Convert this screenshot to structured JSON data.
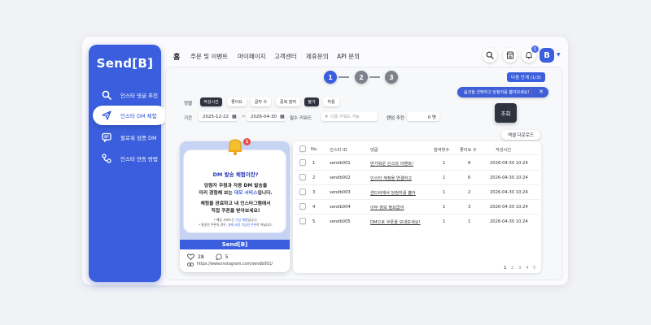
{
  "brand": "Send[B]",
  "sidebar": {
    "items": [
      {
        "label": "인스타 댓글 추천",
        "icon": "search-icon",
        "active": false
      },
      {
        "label": "인스타 DM 체험",
        "icon": "paper-plane-icon",
        "active": true
      },
      {
        "label": "팔로워 검증 DM",
        "icon": "chat-icon",
        "active": false
      },
      {
        "label": "인스타 연동 방법",
        "icon": "link-icon",
        "active": false
      }
    ]
  },
  "header": {
    "home": "홈",
    "menu": [
      "주문 및 이벤트",
      "마이페이지",
      "고객센터",
      "제휴문의",
      "API 문의"
    ],
    "notification_count": "1",
    "avatar": "B"
  },
  "steps": [
    "1",
    "2",
    "3"
  ],
  "active_step": "1",
  "next_step_label": "다음 단계 (1/3)",
  "tooltip": "옵션을 선택하고 당첨자를 뽑아보세요!❗",
  "query_label": "조회",
  "sort": {
    "label": "정렬",
    "buttons": [
      {
        "label": "작성시간",
        "on": true
      },
      {
        "label": "좋아요",
        "on": false
      },
      {
        "label": "글자 수",
        "on": false
      },
      {
        "label": "중복 참여",
        "on": false
      },
      {
        "label": "불가",
        "on": true
      },
      {
        "label": "허용",
        "on": false
      }
    ]
  },
  "filter": {
    "period_label": "기간",
    "start_date": "2025-12-22",
    "end_date": "2026-04-30",
    "date_sep": "~",
    "keyword_label": "필수 키워드",
    "keyword_placeholder": "다중 키워드 가능",
    "pick_label": "랜덤 추천",
    "pick_value": "0 명"
  },
  "excel_label": "엑셀 다운로드",
  "preview": {
    "notif_count": "1",
    "title": "DM 발송 체험이란?",
    "line1": "당첨자 추첨과 자동 DM 발송을",
    "line2a": "미리 경험해 보는 ",
    "line2b": "데모 서비스",
    "line2c": "입니다.",
    "line3": "체험을 완료하고 내 인스타그램에서",
    "line4": "직접 쿠폰을 받아보세요!",
    "note1_a": "* 해당 서비스는 ",
    "note1_b": "가상 체험",
    "note1_c": "입니다.",
    "note2_a": "* 발송된 쿠폰의 경우, ",
    "note2_b": "실제 사용 가능한 쿠폰",
    "note2_c": "이 아닙니다.",
    "brand": "Send[B]",
    "likes": "28",
    "comments": "5",
    "link": "https://www.instagram.com/sendb001/"
  },
  "table": {
    "headers": [
      "No.",
      "인스타 ID",
      "댓글",
      "참여횟수",
      "좋아요 수",
      "작성시간"
    ],
    "rows": [
      {
        "no": "1",
        "id": "sendb001",
        "comment": "반가워운 인스타 이벤트!",
        "count": "1",
        "likes": "8",
        "time": "2026-04-30 10:24"
      },
      {
        "no": "2",
        "id": "sendb002",
        "comment": "인스타 계정을 연결하고",
        "count": "1",
        "likes": "6",
        "time": "2026-04-30 10:24"
      },
      {
        "no": "3",
        "id": "sendb003",
        "comment": "센드비에서 당첨자를 뽑아",
        "count": "1",
        "likes": "2",
        "time": "2026-04-30 10:24"
      },
      {
        "no": "4",
        "id": "sendb004",
        "comment": "이무 정보 필요없어",
        "count": "1",
        "likes": "3",
        "time": "2026-04-30 10:24"
      },
      {
        "no": "5",
        "id": "sendb005",
        "comment": "DM으로 쿠폰을 보내보세요!",
        "count": "1",
        "likes": "1",
        "time": "2026-04-30 10:24"
      }
    ],
    "pages": [
      "1",
      "2",
      "3",
      "4",
      "5"
    ]
  }
}
